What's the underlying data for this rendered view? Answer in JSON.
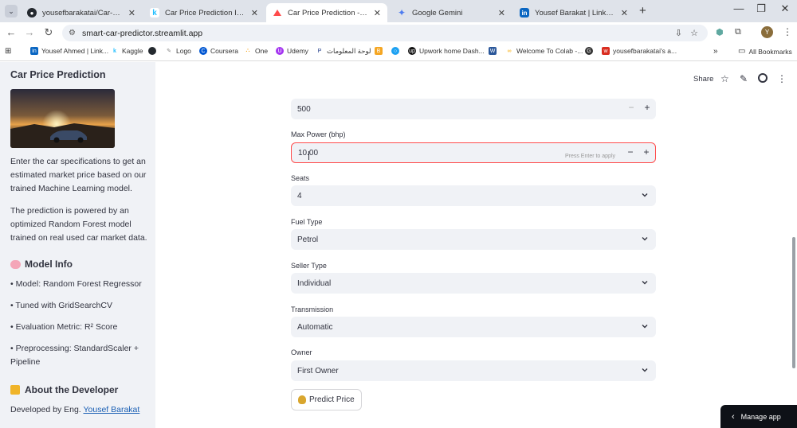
{
  "browser": {
    "tabs": [
      {
        "title": "yousefbarakatai/Car-Price-Predi",
        "icon": "github-icon",
        "color": "#24292f"
      },
      {
        "title": "Car Price Prediction Insights",
        "icon": "kaggle-icon",
        "color": "#20beff"
      },
      {
        "title": "Car Price Prediction - Streamlit",
        "icon": "streamlit-icon",
        "color": "#ff4b4b"
      },
      {
        "title": "Google Gemini",
        "icon": "gemini-icon",
        "color": "#4e7cf0"
      },
      {
        "title": "Yousef Barakat | LinkedIn",
        "icon": "linkedin-icon",
        "color": "#0a66c2"
      }
    ],
    "url": "smart-car-predictor.streamlit.app",
    "bookmarks": [
      {
        "label": "Yousef Ahmed | Link...",
        "color": "#0a66c2"
      },
      {
        "label": "Kaggle",
        "color": "#20beff"
      },
      {
        "label": "",
        "color": "#24292f"
      },
      {
        "label": "Logo",
        "color": "#888888"
      },
      {
        "label": "Coursera",
        "color": "#0056d2"
      },
      {
        "label": "One",
        "color": "#f59e0b"
      },
      {
        "label": "Udemy",
        "color": "#a435f0"
      },
      {
        "label": "لوحة المعلومات",
        "color": "#1e3a8a"
      },
      {
        "label": "",
        "color": "#f5a623"
      },
      {
        "label": "",
        "color": "#1da1f2"
      },
      {
        "label": "Upwork home Dash...",
        "color": "#111111"
      },
      {
        "label": "",
        "color": "#2b579a"
      },
      {
        "label": "Welcome To Colab -...",
        "color": "#f9ab00"
      },
      {
        "label": "",
        "color": "#333333"
      },
      {
        "label": "yousefbarakatai's a...",
        "color": "#d92d20"
      }
    ],
    "all_bookmarks": "All Bookmarks",
    "avatar_letter": "Y"
  },
  "sidebar": {
    "title": "Car Price Prediction",
    "intro": "Enter the car specifications to get an estimated market price based on our trained Machine Learning model.",
    "powered": "The prediction is powered by an optimized Random Forest model trained on real used car market data.",
    "model_info_heading": "Model Info",
    "model_items": [
      "• Model: Random Forest Regressor",
      "• Tuned with GridSearchCV",
      "• Evaluation Metric: R² Score",
      "• Preprocessing: StandardScaler + Pipeline"
    ],
    "developer_heading": "About the Developer",
    "developed_by": "Developed by Eng.",
    "developer_name": "Yousef Barakat"
  },
  "header": {
    "share": "Share"
  },
  "form": {
    "top_value": "500",
    "max_power_label": "Max Power (bhp)",
    "max_power_value": "10.00",
    "max_power_hint": "Press Enter to apply",
    "seats_label": "Seats",
    "seats_value": "4",
    "fuel_label": "Fuel Type",
    "fuel_value": "Petrol",
    "seller_label": "Seller Type",
    "seller_value": "Individual",
    "transmission_label": "Transmission",
    "transmission_value": "Automatic",
    "owner_label": "Owner",
    "owner_value": "First Owner",
    "predict_button": "Predict Price"
  },
  "manage": {
    "label": "Manage app"
  },
  "colors": {
    "accent": "#ff4b4b",
    "sidebar_bg": "#f0f2f6",
    "link": "#1a5fb4"
  }
}
